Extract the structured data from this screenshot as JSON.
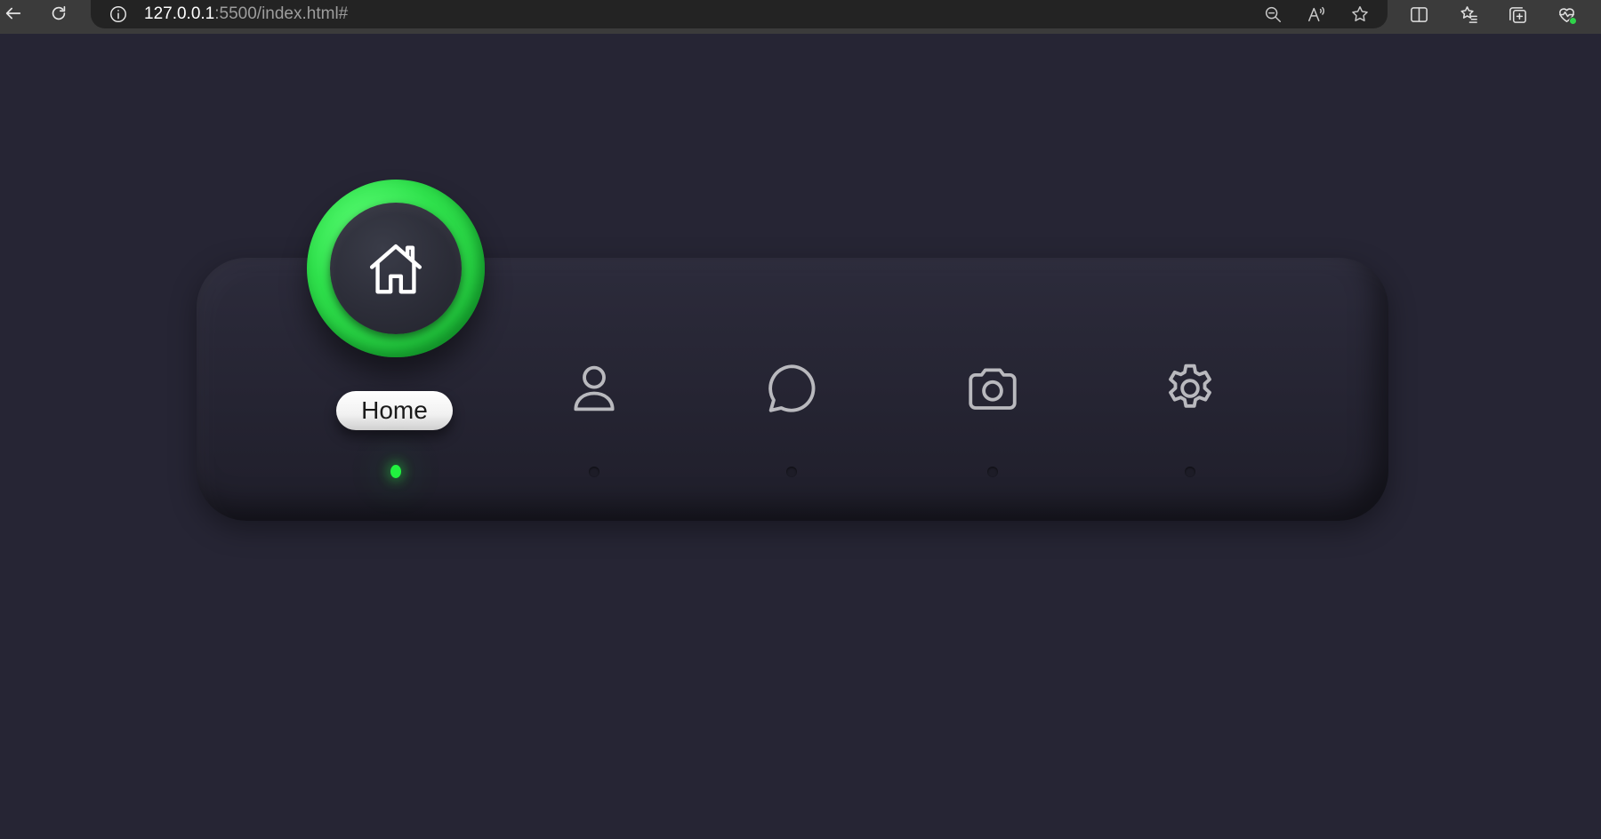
{
  "browser": {
    "url_host": "127.0.0.1",
    "url_path": ":5500/index.html#",
    "icons": [
      "back-arrow-icon",
      "refresh-icon",
      "info-icon",
      "zoom-out-icon",
      "read-aloud-icon",
      "favorite-star-icon",
      "split-screen-icon",
      "favorites-icon",
      "collections-icon",
      "browser-health-icon"
    ]
  },
  "nav": {
    "active_index": 0,
    "accent_color": "#21f23f",
    "items": [
      {
        "label": "Home",
        "icon": "home-icon"
      },
      {
        "label": "",
        "icon": "user-icon"
      },
      {
        "label": "",
        "icon": "chat-icon"
      },
      {
        "label": "",
        "icon": "camera-icon"
      },
      {
        "label": "",
        "icon": "settings-icon"
      }
    ]
  }
}
